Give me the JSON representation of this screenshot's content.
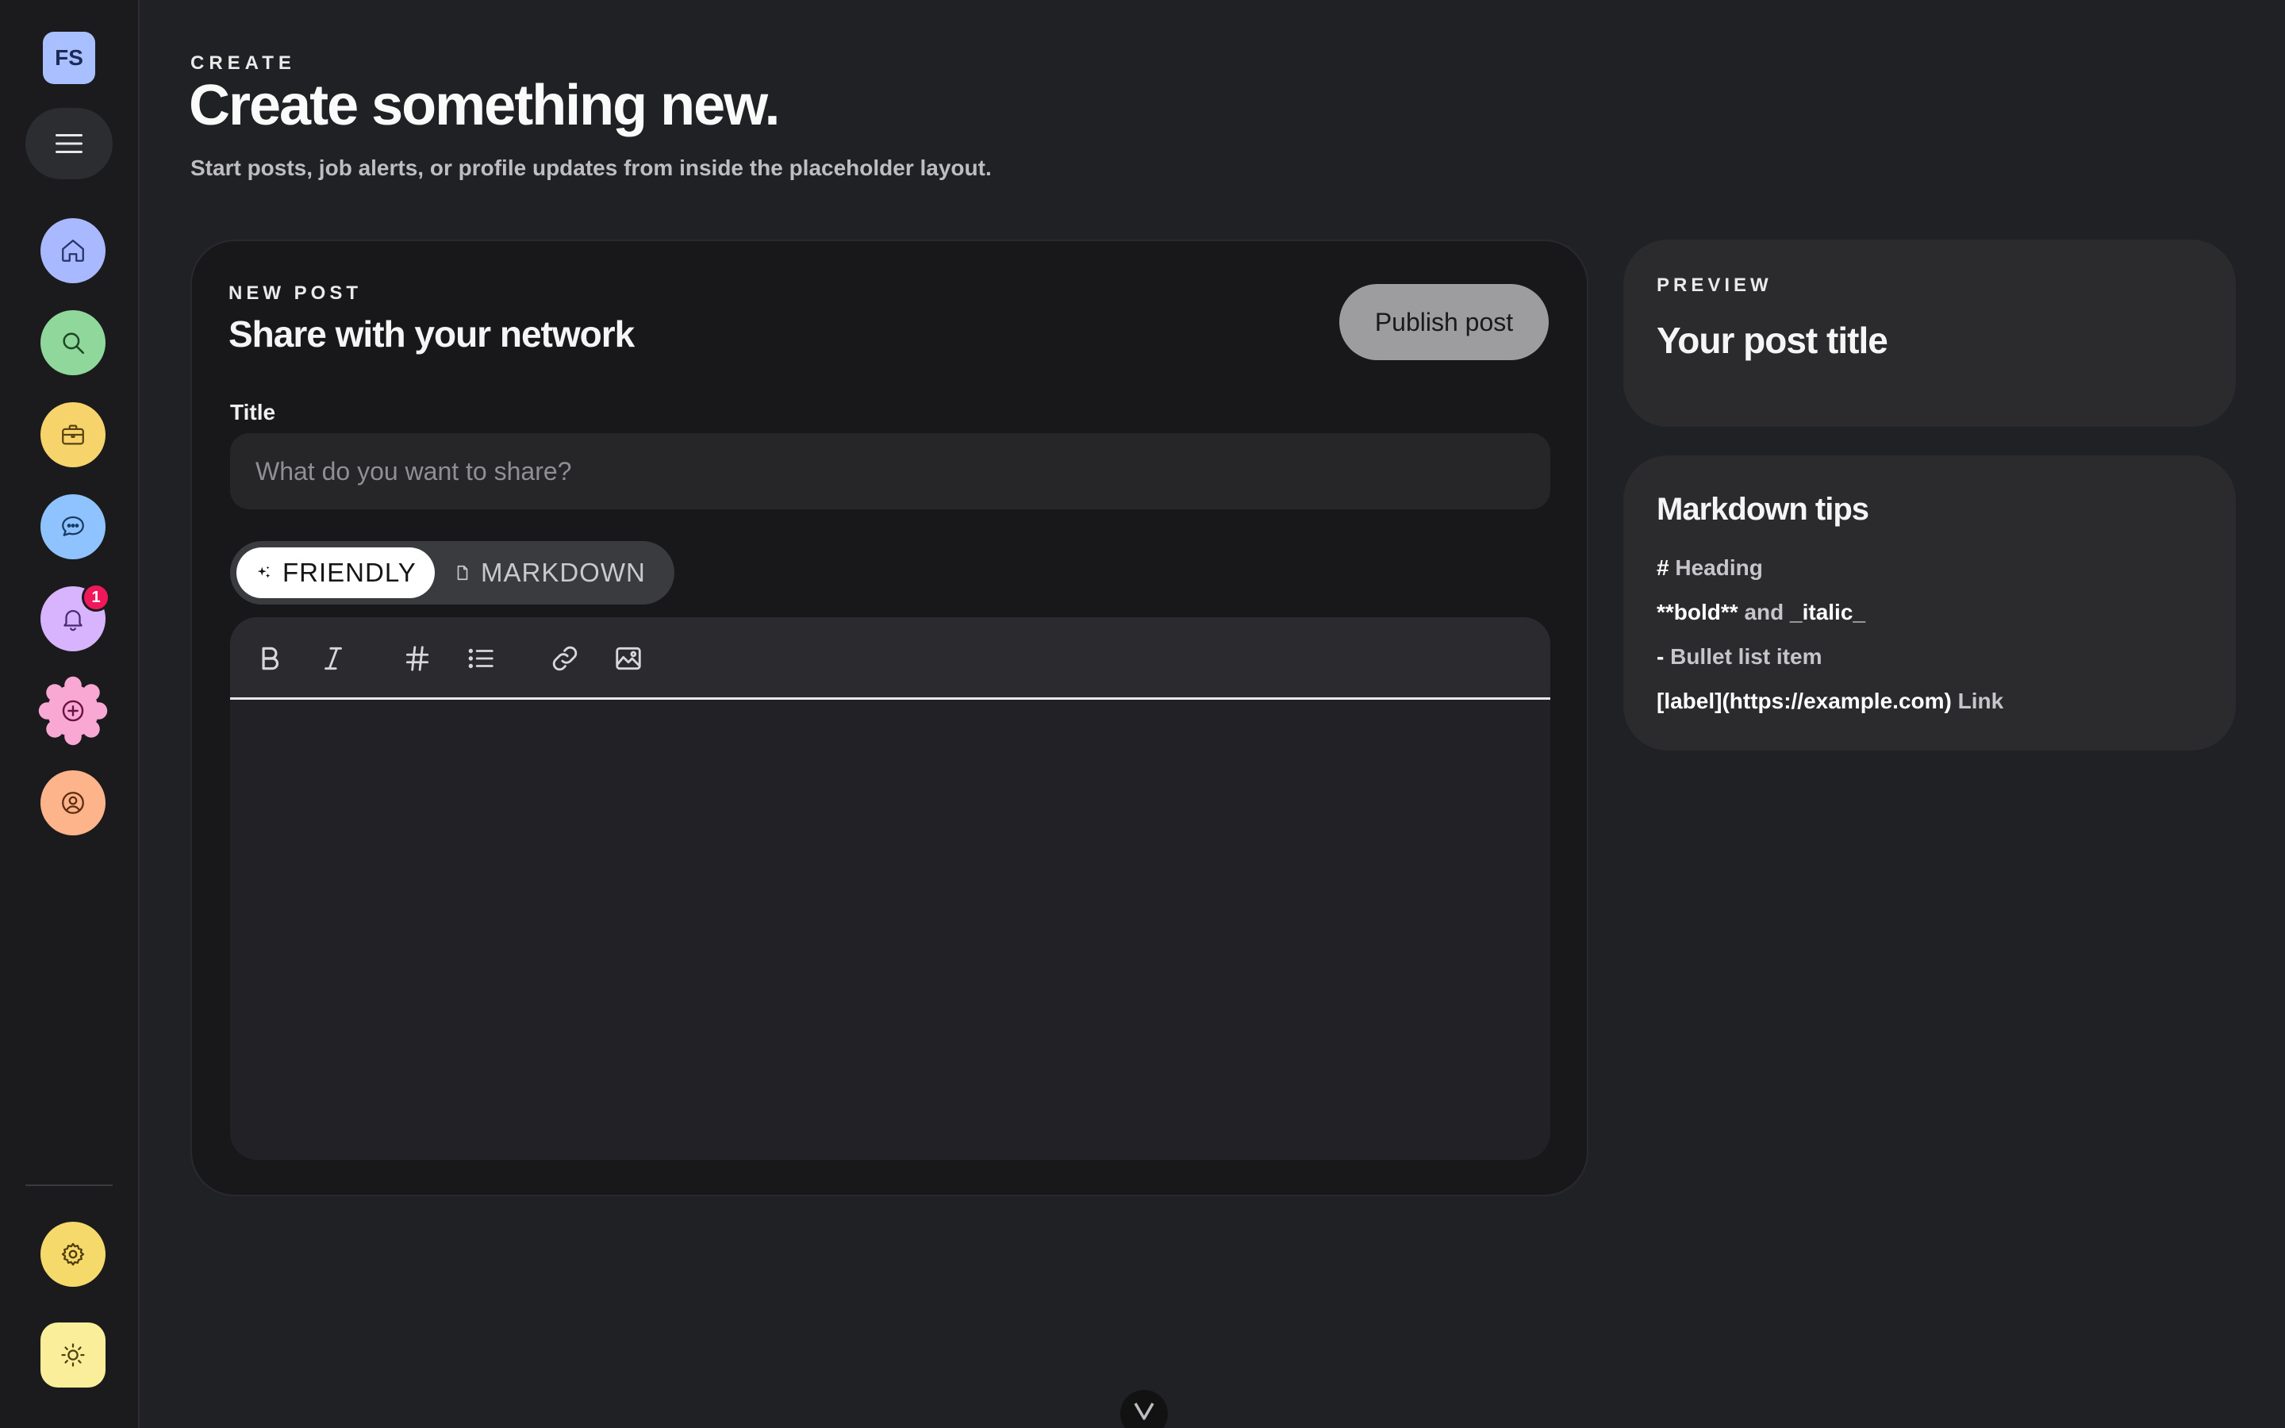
{
  "colors": {
    "background": "#202124",
    "sidebar": "#1b1b1d",
    "card": "#18181a",
    "panel": "#2b2b2e",
    "badge": "#f0185a"
  },
  "sidebar": {
    "avatar_initials": "FS",
    "menu_icon": "hamburger-icon",
    "nav": [
      {
        "icon": "home-icon",
        "color": "#a8b9ff"
      },
      {
        "icon": "search-icon",
        "color": "#8fd79b"
      },
      {
        "icon": "briefcase-icon",
        "color": "#f6d46b"
      },
      {
        "icon": "chat-icon",
        "color": "#8fc3ff"
      },
      {
        "icon": "bell-icon",
        "color": "#d8b4fe",
        "badge": "1"
      },
      {
        "icon": "plus-circle-icon",
        "color": "#f9a8d4"
      },
      {
        "icon": "user-circle-icon",
        "color": "#fdb48a"
      }
    ],
    "settings_icon": "gear-icon",
    "theme_icon": "sun-icon"
  },
  "header": {
    "eyebrow": "CREATE",
    "title": "Create something new.",
    "subtitle": "Start posts, job alerts, or profile updates from inside the placeholder layout."
  },
  "composer": {
    "eyebrow": "NEW POST",
    "title": "Share with your network",
    "publish_label": "Publish post",
    "title_label": "Title",
    "title_placeholder": "What do you want to share?",
    "modes": {
      "friendly": "FRIENDLY",
      "markdown": "MARKDOWN",
      "selected": "friendly"
    },
    "toolbar": [
      "bold-icon",
      "italic-icon",
      "heading-icon",
      "list-icon",
      "link-icon",
      "image-icon"
    ]
  },
  "preview": {
    "eyebrow": "PREVIEW",
    "title": "Your post title"
  },
  "tips": {
    "title": "Markdown tips",
    "heading_code": "#",
    "heading_text": "Heading",
    "bold_code": "**bold**",
    "and": "and",
    "italic_code": "_italic_",
    "bullet_code": "-",
    "bullet_text": "Bullet list item",
    "link_code": "[label](https://example.com)",
    "link_text": "Link"
  }
}
